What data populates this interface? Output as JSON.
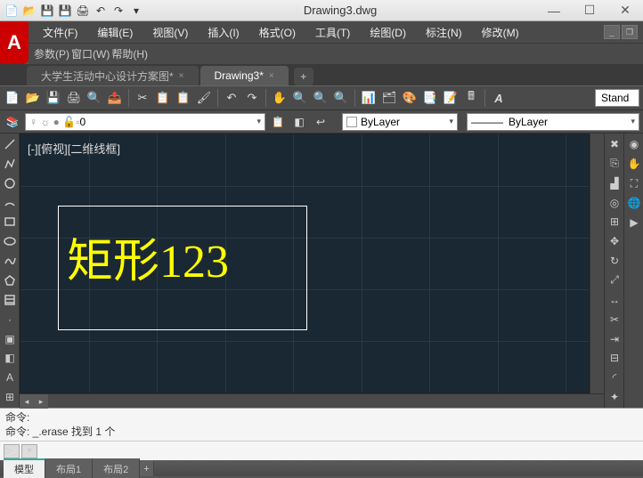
{
  "title": "Drawing3.dwg",
  "menus1": [
    "文件(F)",
    "编辑(E)",
    "视图(V)",
    "插入(I)",
    "格式(O)",
    "工具(T)",
    "绘图(D)",
    "标注(N)",
    "修改(M)"
  ],
  "menus2": [
    "参数(P)",
    "窗口(W)",
    "帮助(H)"
  ],
  "tabs": [
    {
      "label": "大学生活动中心设计方案图*",
      "active": false
    },
    {
      "label": "Drawing3*",
      "active": true
    }
  ],
  "style_box": "Stand",
  "layer": {
    "name": "0",
    "icons_prefix": "♀ ☼ ⚪ 🔓 "
  },
  "color_combo": "ByLayer",
  "linetype_combo": "ByLayer",
  "viewport_label": "[-][俯视][二维线框]",
  "canvas_text": "矩形123",
  "cmd_hist": [
    "命令:",
    "命令: _.erase 找到 1 个"
  ],
  "cmd_placeholder": "",
  "status_tabs": [
    {
      "label": "模型",
      "active": true
    },
    {
      "label": "布局1",
      "active": false
    },
    {
      "label": "布局2",
      "active": false
    }
  ]
}
